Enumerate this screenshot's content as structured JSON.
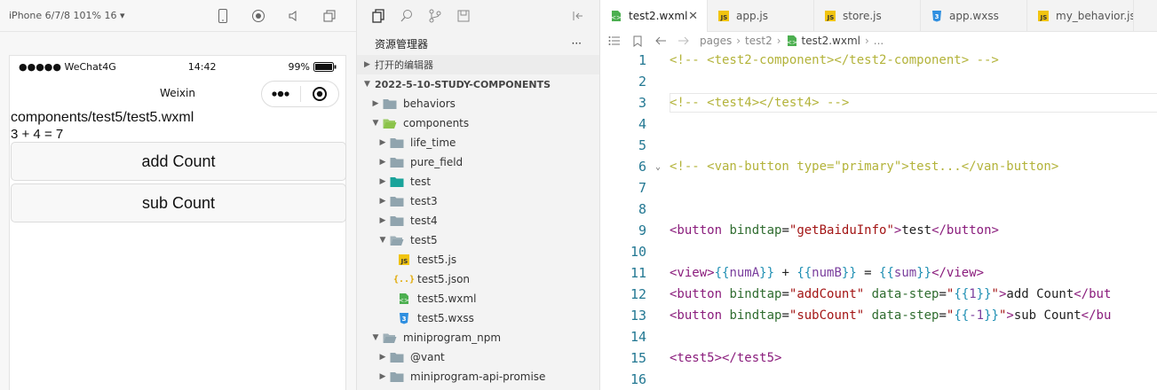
{
  "simulator": {
    "device_label": "iPhone 6/7/8 101% 16 ▾",
    "status": {
      "carrier": "●●●●● WeChat4G",
      "time": "14:42",
      "battery": "99%"
    },
    "nav_title": "Weixin",
    "page_path": "components/test5/test5.wxml",
    "sum_text": "3 + 4 = 7",
    "buttons": [
      "add Count",
      "sub Count"
    ]
  },
  "explorer": {
    "title": "资源管理器",
    "more": "···",
    "open_editors": "打开的编辑器",
    "project": "2022-5-10-STUDY-COMPONENTS",
    "tree": [
      {
        "label": "behaviors",
        "depth": 1,
        "type": "folder",
        "open": false
      },
      {
        "label": "components",
        "depth": 1,
        "type": "folder-green",
        "open": true
      },
      {
        "label": "life_time",
        "depth": 2,
        "type": "folder",
        "open": false
      },
      {
        "label": "pure_field",
        "depth": 2,
        "type": "folder",
        "open": false
      },
      {
        "label": "test",
        "depth": 2,
        "type": "folder-teal",
        "open": false
      },
      {
        "label": "test3",
        "depth": 2,
        "type": "folder",
        "open": false
      },
      {
        "label": "test4",
        "depth": 2,
        "type": "folder",
        "open": false
      },
      {
        "label": "test5",
        "depth": 2,
        "type": "folder",
        "open": true
      },
      {
        "label": "test5.js",
        "depth": 3,
        "type": "js"
      },
      {
        "label": "test5.json",
        "depth": 3,
        "type": "json"
      },
      {
        "label": "test5.wxml",
        "depth": 3,
        "type": "wxml"
      },
      {
        "label": "test5.wxss",
        "depth": 3,
        "type": "wxss"
      },
      {
        "label": "miniprogram_npm",
        "depth": 1,
        "type": "folder",
        "open": true
      },
      {
        "label": "@vant",
        "depth": 2,
        "type": "folder",
        "open": false
      },
      {
        "label": "miniprogram-api-promise",
        "depth": 2,
        "type": "folder",
        "open": false
      }
    ]
  },
  "editor": {
    "tabs": [
      {
        "label": "test2.wxml",
        "icon": "wxml",
        "active": true
      },
      {
        "label": "app.js",
        "icon": "js",
        "active": false
      },
      {
        "label": "store.js",
        "icon": "js",
        "active": false
      },
      {
        "label": "app.wxss",
        "icon": "wxss",
        "active": false
      },
      {
        "label": "my_behavior.js",
        "icon": "js",
        "active": false
      }
    ],
    "close_glyph": "✕",
    "breadcrumbs": [
      "pages",
      "test2",
      "test2.wxml",
      "..."
    ],
    "lines": [
      {
        "n": "1",
        "tokens": [
          [
            "c-com",
            "<!-- <test2-component></test2-component> -->"
          ]
        ]
      },
      {
        "n": "2",
        "tokens": []
      },
      {
        "n": "3",
        "tokens": [
          [
            "c-com",
            "<!-- <test4></test4> -->"
          ]
        ],
        "highlight": true
      },
      {
        "n": "4",
        "tokens": []
      },
      {
        "n": "5",
        "tokens": []
      },
      {
        "n": "6",
        "fold": true,
        "tokens": [
          [
            "c-com",
            "<!-- <van-button type=\"primary\">test...</van-button>"
          ]
        ]
      },
      {
        "n": "7",
        "tokens": []
      },
      {
        "n": "8",
        "tokens": []
      },
      {
        "n": "9",
        "tokens": [
          [
            "c-tag",
            "<button "
          ],
          [
            "c-attr",
            "bindtap"
          ],
          [
            "c-txt",
            "="
          ],
          [
            "c-str",
            "\"getBaiduInfo\""
          ],
          [
            "c-tag",
            ">"
          ],
          [
            "c-txt",
            "test"
          ],
          [
            "c-tag",
            "</button>"
          ]
        ]
      },
      {
        "n": "10",
        "tokens": []
      },
      {
        "n": "11",
        "tokens": [
          [
            "c-tag",
            "<view>"
          ],
          [
            "c-mus",
            "{{"
          ],
          [
            "c-var",
            "numA"
          ],
          [
            "c-mus",
            "}}"
          ],
          [
            "c-txt",
            " + "
          ],
          [
            "c-mus",
            "{{"
          ],
          [
            "c-var",
            "numB"
          ],
          [
            "c-mus",
            "}}"
          ],
          [
            "c-txt",
            " = "
          ],
          [
            "c-mus",
            "{{"
          ],
          [
            "c-var",
            "sum"
          ],
          [
            "c-mus",
            "}}"
          ],
          [
            "c-tag",
            "</view>"
          ]
        ]
      },
      {
        "n": "12",
        "tokens": [
          [
            "c-tag",
            "<button "
          ],
          [
            "c-attr",
            "bindtap"
          ],
          [
            "c-txt",
            "="
          ],
          [
            "c-str",
            "\"addCount\""
          ],
          [
            "c-txt",
            " "
          ],
          [
            "c-attr",
            "data-step"
          ],
          [
            "c-txt",
            "="
          ],
          [
            "c-str",
            "\""
          ],
          [
            "c-mus",
            "{{"
          ],
          [
            "c-var",
            "1"
          ],
          [
            "c-mus",
            "}}"
          ],
          [
            "c-str",
            "\""
          ],
          [
            "c-tag",
            ">"
          ],
          [
            "c-txt",
            "add Count"
          ],
          [
            "c-tag",
            "</but"
          ]
        ]
      },
      {
        "n": "13",
        "tokens": [
          [
            "c-tag",
            "<button "
          ],
          [
            "c-attr",
            "bindtap"
          ],
          [
            "c-txt",
            "="
          ],
          [
            "c-str",
            "\"subCount\""
          ],
          [
            "c-txt",
            " "
          ],
          [
            "c-attr",
            "data-step"
          ],
          [
            "c-txt",
            "="
          ],
          [
            "c-str",
            "\""
          ],
          [
            "c-mus",
            "{{"
          ],
          [
            "c-var",
            "-1"
          ],
          [
            "c-mus",
            "}}"
          ],
          [
            "c-str",
            "\""
          ],
          [
            "c-tag",
            ">"
          ],
          [
            "c-txt",
            "sub Count"
          ],
          [
            "c-tag",
            "</bu"
          ]
        ]
      },
      {
        "n": "14",
        "tokens": []
      },
      {
        "n": "15",
        "tokens": [
          [
            "c-tag",
            "<test5></test5>"
          ]
        ]
      },
      {
        "n": "16",
        "tokens": []
      }
    ]
  }
}
